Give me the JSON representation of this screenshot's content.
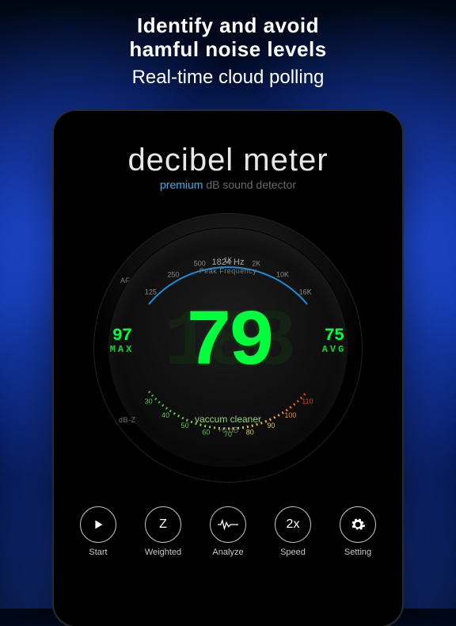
{
  "promo": {
    "line1": "Identify and avoid",
    "line2": "hamful noise levels",
    "line3": "Real-time cloud polling"
  },
  "app": {
    "title": "decibel meter",
    "subtitle_premium": "premium",
    "subtitle_desc": " dB sound detector"
  },
  "dial": {
    "peak_value": "1824 Hz",
    "peak_label": "Peak Frequency",
    "db_value": "79",
    "ghost": "188",
    "max_value": "97",
    "max_label": "MAX",
    "avg_value": "75",
    "avg_label": "AVG",
    "reference": "vaccum cleaner",
    "calibration": "+0 dB",
    "top_scale_label": "AF",
    "bottom_scale_label": "dB-Z",
    "freq_ticks": [
      "125",
      "250",
      "500",
      "1K",
      "2K",
      "10K",
      "16K"
    ],
    "db_ticks": [
      "30",
      "40",
      "50",
      "60",
      "70",
      "80",
      "90",
      "100",
      "110"
    ]
  },
  "controls": [
    {
      "icon": "play",
      "label": "Start"
    },
    {
      "icon": "Z",
      "label": "Weighted"
    },
    {
      "icon": "analyze",
      "label": "Analyze"
    },
    {
      "icon": "2x",
      "label": "Speed"
    },
    {
      "icon": "gear",
      "label": "Setting"
    }
  ]
}
